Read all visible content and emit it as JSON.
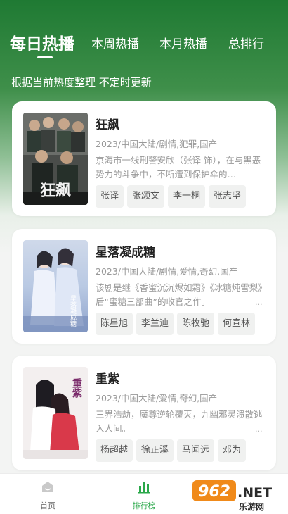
{
  "tabs": [
    {
      "label": "每日热播",
      "active": true
    },
    {
      "label": "本周热播",
      "active": false
    },
    {
      "label": "本月热播",
      "active": false
    },
    {
      "label": "总排行",
      "active": false
    }
  ],
  "subtitle": "根据当前热度整理 不定时更新",
  "dramas": [
    {
      "title": "狂飙",
      "meta": "2023/中国大陆/剧情,犯罪,国产",
      "description": "京海市一线刑警安欣（张译 饰），在与黑恶势力的斗争中，不断遭到保护伞的…",
      "more": "...",
      "cast": [
        "张译",
        "张颂文",
        "李一桐",
        "张志坚"
      ],
      "poster_text": "狂飙"
    },
    {
      "title": "星落凝成糖",
      "meta": "2023/中国大陆/剧情,爱情,奇幻,国产",
      "description": "该剧是继《香蜜沉沉烬如霜》《冰糖炖雪梨》后“蜜糖三部曲”的收官之作。",
      "more": "...",
      "cast": [
        "陈星旭",
        "李兰迪",
        "陈牧驰",
        "何宣林"
      ],
      "poster_text": "星落凝成糖"
    },
    {
      "title": "重紫",
      "meta": "2023/中国大陆/爱情,奇幻,国产",
      "description": "三界浩劫，魔尊逆轮覆灭，九幽邪灵溃散逃入人间。",
      "more": "...",
      "cast": [
        "杨超越",
        "徐正溪",
        "马闻远",
        "邓为"
      ],
      "poster_text": "重紫"
    }
  ],
  "bottom_nav": [
    {
      "label": "首页",
      "icon": "home-icon",
      "active": false
    },
    {
      "label": "排行榜",
      "icon": "bar-chart-icon",
      "active": true
    }
  ],
  "watermark": {
    "brand": "962",
    "suffix": ".NET",
    "sub": "乐游网"
  },
  "colors": {
    "accent": "#2aa84a",
    "header_dark": "#1f7a33"
  }
}
